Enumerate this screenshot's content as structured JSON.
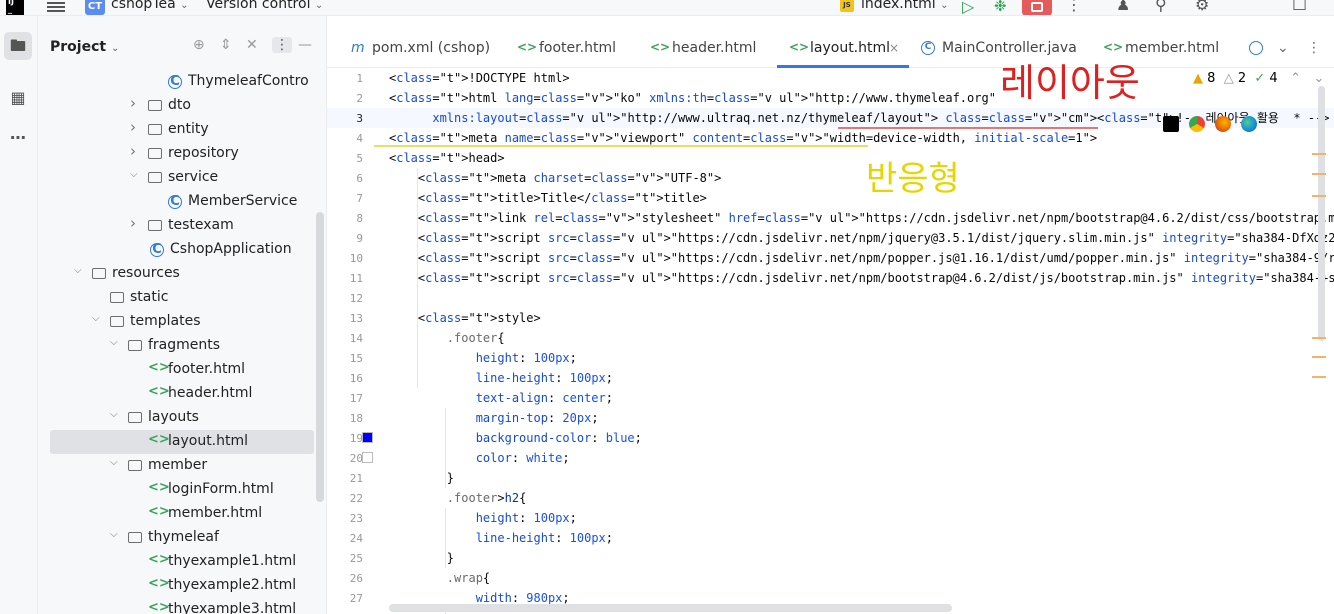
{
  "titlebar": {
    "project_badge": "CT",
    "project_name": "cshopTea",
    "vcs": "Version control",
    "run_config": "index.html",
    "js_badge": "JS"
  },
  "project_panel": {
    "title": "Project",
    "tree": [
      {
        "label": "ThymeleafContro",
        "kind": "class",
        "indent": 168,
        "arrow": ""
      },
      {
        "label": "dto",
        "kind": "folder",
        "indent": 148,
        "arrow": "right"
      },
      {
        "label": "entity",
        "kind": "folder",
        "indent": 148,
        "arrow": "right"
      },
      {
        "label": "repository",
        "kind": "folder",
        "indent": 148,
        "arrow": "right"
      },
      {
        "label": "service",
        "kind": "folder",
        "indent": 148,
        "arrow": "down"
      },
      {
        "label": "MemberService",
        "kind": "class",
        "indent": 168,
        "arrow": ""
      },
      {
        "label": "testexam",
        "kind": "folder",
        "indent": 148,
        "arrow": "right"
      },
      {
        "label": "CshopApplication",
        "kind": "class",
        "indent": 150,
        "arrow": ""
      },
      {
        "label": "resources",
        "kind": "folder",
        "indent": 92,
        "arrow": "down"
      },
      {
        "label": "static",
        "kind": "folder",
        "indent": 110,
        "arrow": ""
      },
      {
        "label": "templates",
        "kind": "folder",
        "indent": 110,
        "arrow": "down"
      },
      {
        "label": "fragments",
        "kind": "folder",
        "indent": 128,
        "arrow": "down"
      },
      {
        "label": "footer.html",
        "kind": "html",
        "indent": 148,
        "arrow": ""
      },
      {
        "label": "header.html",
        "kind": "html",
        "indent": 148,
        "arrow": ""
      },
      {
        "label": "layouts",
        "kind": "folder",
        "indent": 128,
        "arrow": "down"
      },
      {
        "label": "layout.html",
        "kind": "html",
        "indent": 148,
        "arrow": "",
        "selected": true
      },
      {
        "label": "member",
        "kind": "folder",
        "indent": 128,
        "arrow": "down"
      },
      {
        "label": "loginForm.html",
        "kind": "html",
        "indent": 148,
        "arrow": ""
      },
      {
        "label": "member.html",
        "kind": "html",
        "indent": 148,
        "arrow": ""
      },
      {
        "label": "thymeleaf",
        "kind": "folder",
        "indent": 128,
        "arrow": "down"
      },
      {
        "label": "thyexample1.html",
        "kind": "html",
        "indent": 148,
        "arrow": ""
      },
      {
        "label": "thyexample2.html",
        "kind": "html",
        "indent": 148,
        "arrow": ""
      },
      {
        "label": "thyexample3.html",
        "kind": "html",
        "indent": 148,
        "arrow": ""
      }
    ]
  },
  "tabs": [
    {
      "icon": "m",
      "label": "pom.xml (cshop)",
      "active": false
    },
    {
      "icon": "<>",
      "label": "footer.html",
      "active": false
    },
    {
      "icon": "<>",
      "label": "header.html",
      "active": false
    },
    {
      "icon": "<>",
      "label": "layout.html",
      "active": true,
      "close": "×"
    },
    {
      "icon": "C",
      "label": "MainController.java",
      "active": false
    },
    {
      "icon": "<>",
      "label": "member.html",
      "active": false
    }
  ],
  "inspections": {
    "warnings": "8",
    "weak_warnings": "2",
    "ok": "4"
  },
  "line_numbers": [
    "1",
    "2",
    "3",
    "4",
    "5",
    "6",
    "7",
    "8",
    "9",
    "10",
    "11",
    "12",
    "13",
    "14",
    "15",
    "16",
    "17",
    "18",
    "19",
    "20",
    "21",
    "22",
    "23",
    "24",
    "25",
    "26",
    "27"
  ],
  "current_line": "3",
  "code_lines": [
    "<!DOCTYPE html>",
    "<html lang=\"ko\" xmlns:th=\"http://www.thymeleaf.org\"",
    "      xmlns:layout=\"http://www.ultraq.net.nz/thymeleaf/layout\"> <!-- 레이아웃 활용  * -->",
    "<meta name=\"viewport\" content=\"width=device-width, initial-scale=1\">",
    "<head>",
    "    <meta charset=\"UTF-8\">",
    "    <title>Title</title>",
    "    <link rel=\"stylesheet\" href=\"https://cdn.jsdelivr.net/npm/bootstrap@4.6.2/dist/css/bootstrap.min.css\" integrity=\"sha384-xOolHFLEh0",
    "    <script src=\"https://cdn.jsdelivr.net/npm/jquery@3.5.1/dist/jquery.slim.min.js\" integrity=\"sha384-DfXdz2htPH0lsSSs5nCTpuj/zy4C+OGp",
    "    <script src=\"https://cdn.jsdelivr.net/npm/popper.js@1.16.1/dist/umd/popper.min.js\" integrity=\"sha384-9/reFTGAW83EW2RDu2S0VKaIzap3H",
    "    <script src=\"https://cdn.jsdelivr.net/npm/bootstrap@4.6.2/dist/js/bootstrap.min.js\" integrity=\"sha384-+sLIOodYLS7CIrQpBjl+C7nPvqq+",
    "",
    "    <style>",
    "        .footer{",
    "            height: 100px;",
    "            line-height: 100px;",
    "            text-align: center;",
    "            margin-top: 20px;",
    "            background-color: blue;",
    "            color: white;",
    "        }",
    "        .footer>h2{",
    "            height: 100px;",
    "            line-height: 100px;",
    "        }",
    "        .wrap{",
    "            width: 980px;"
  ],
  "gutter_swatches": [
    {
      "line": "19",
      "color": "#0000ff"
    },
    {
      "line": "20",
      "color": "#ffffff"
    }
  ],
  "handwriting": {
    "top": "레이아웃",
    "middle": "반응형",
    "color_top": "#e02020",
    "color_middle": "#e8d400"
  },
  "colors": {
    "accent": "#3574f0",
    "stop_button": "#e55b5b",
    "run_green": "#2da44e"
  }
}
